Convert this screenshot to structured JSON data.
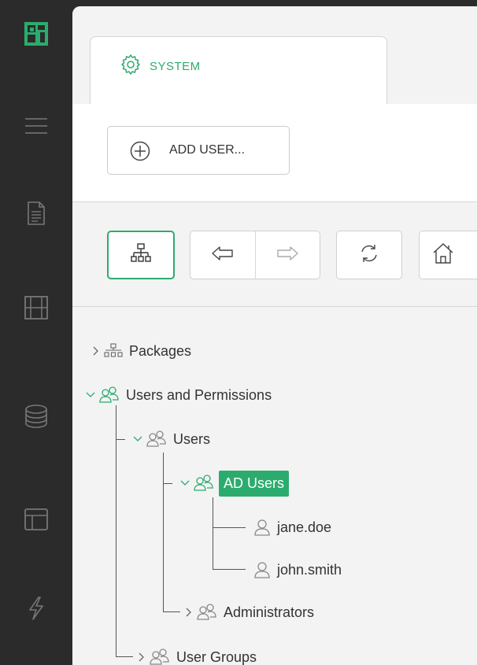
{
  "rail": {
    "items": [
      {
        "name": "app-logo-icon"
      },
      {
        "name": "menu-icon"
      },
      {
        "name": "document-icon"
      },
      {
        "name": "film-icon"
      },
      {
        "name": "database-icon"
      },
      {
        "name": "layout-icon"
      },
      {
        "name": "flash-icon"
      }
    ]
  },
  "tabs": [
    {
      "label": "SYSTEM",
      "icon": "gear-icon",
      "active": true
    }
  ],
  "toolbar": {
    "add_user_label": "ADD USER...",
    "add_user_icon": "plus-circle-icon",
    "nav_buttons": [
      "tree-view-icon",
      "back-arrow-icon",
      "forward-arrow-icon",
      "refresh-icon",
      "home-icon"
    ]
  },
  "tree": {
    "packages": "Packages",
    "users_and_permissions": "Users and Permissions",
    "users": "Users",
    "ad_users": "AD Users",
    "jane": "jane.doe",
    "john": "john.smith",
    "administrators": "Administrators",
    "user_groups": "User Groups"
  },
  "colors": {
    "accent": "#2bac6e",
    "rail": "#2b2b2b",
    "panel": "#f3f3f3"
  }
}
